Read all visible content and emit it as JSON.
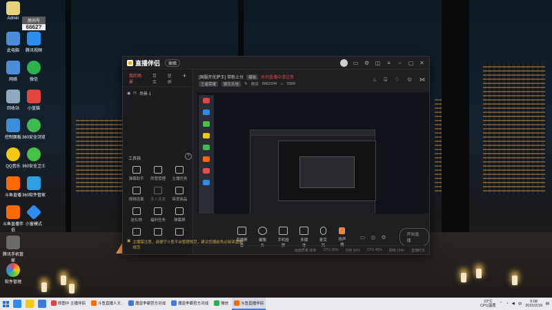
{
  "desktop": {
    "icons": [
      {
        "label": "Admin",
        "color": "#e8d27a"
      },
      {
        "label": "房间号",
        "color": "#5a5a5a"
      },
      {
        "label": "此电脑",
        "color": "#4a8fd8"
      },
      {
        "label": "腾讯视频",
        "color": "#2d8cf0"
      },
      {
        "label": "网络",
        "color": "#4a8fd8"
      },
      {
        "label": "微信",
        "color": "#2bb24c"
      },
      {
        "label": "回收站",
        "color": "#8fa7bf"
      },
      {
        "label": "小蓝猫",
        "color": "#e0463e"
      },
      {
        "label": "控制面板",
        "color": "#3a8fd8"
      },
      {
        "label": "360安全浏览",
        "color": "#3fb950"
      },
      {
        "label": "QQ音乐",
        "color": "#f2c811"
      },
      {
        "label": "360安全卫士",
        "color": "#46c346"
      },
      {
        "label": "斗鱼直播",
        "color": "#ff6a00"
      },
      {
        "label": "360软件管家",
        "color": "#2d9ee0"
      },
      {
        "label": "斗鱼直播伴侣",
        "color": "#ff6a00"
      },
      {
        "label": "小窗模式",
        "color": "#2d8cf0"
      },
      {
        "label": "腾讯手机管家",
        "color": "#6b6b6b"
      },
      {
        "label": "软件管理",
        "color": "#e64a4a"
      }
    ],
    "room_overlay": "6662?"
  },
  "app": {
    "title": "直播伴侣",
    "version_badge": "体验",
    "left_tabs": [
      {
        "label": "我的场景",
        "active": true
      },
      {
        "label": "百合",
        "active": false
      },
      {
        "label": "竖屏",
        "active": false
      }
    ],
    "scene_label": "场景 1",
    "tools_title": "工具箱",
    "tools": [
      {
        "label": "弹幕助手",
        "dim": false
      },
      {
        "label": "房管管理",
        "dim": false
      },
      {
        "label": "主播任务",
        "dim": false
      },
      {
        "label": "视频连麦",
        "dim": false
      },
      {
        "label": "多人连麦",
        "dim": true
      },
      {
        "label": "带货商品",
        "dim": false
      },
      {
        "label": "送礼物",
        "dim": false
      },
      {
        "label": "福利任务",
        "dim": false
      },
      {
        "label": "弹幕屏",
        "dim": false
      },
      {
        "label": "",
        "dim": false
      },
      {
        "label": "",
        "dim": false
      },
      {
        "label": "",
        "dim": false
      }
    ],
    "stream_title": "[国服开优萨王] 带粉上分",
    "tag1": "编辑",
    "red_notice": "系列直播中请注意",
    "line2": {
      "category": "王者荣耀",
      "sub": "娱乐天地",
      "room_label": "房间",
      "room_id": "6662334",
      "fans": "5566"
    },
    "controls": [
      {
        "label": "直播屏幕",
        "kind": "box"
      },
      {
        "label": "摄像头",
        "kind": "box"
      },
      {
        "label": "手机投屏",
        "kind": "box"
      },
      {
        "label": "多媒体",
        "kind": "box"
      },
      {
        "label": "麦克风",
        "kind": "mic"
      },
      {
        "label": "扬声器",
        "kind": "spk"
      }
    ],
    "start_button": "开始直播",
    "notice": "主播需注意，请遵守斗鱼平台管理规范，建议您播前务必阅读直播规范",
    "status": [
      "画面质量 帧率",
      "CPU 35%",
      "内存 60%",
      "CPU 40%",
      "网络 18kb",
      "直播时长"
    ]
  },
  "taskbar": {
    "tasks": [
      {
        "label": "修图中 主播伴侣",
        "color": "#e04545",
        "active": false
      },
      {
        "label": "斗鱼直播人文..",
        "color": "#ff6a00",
        "active": false
      },
      {
        "label": "魔兽争霸官方对战",
        "color": "#3b7be0",
        "active": false
      },
      {
        "label": "魔兽争霸官方对战",
        "color": "#3b7be0",
        "active": false
      },
      {
        "label": "微信",
        "color": "#2bb24c",
        "active": false
      },
      {
        "label": "斗鱼直播伴侣",
        "color": "#ff6a00",
        "active": true
      }
    ],
    "weather_top": "22°C",
    "weather_bottom": "CPU温度",
    "time": "5:08",
    "date": "2022/2/19"
  }
}
